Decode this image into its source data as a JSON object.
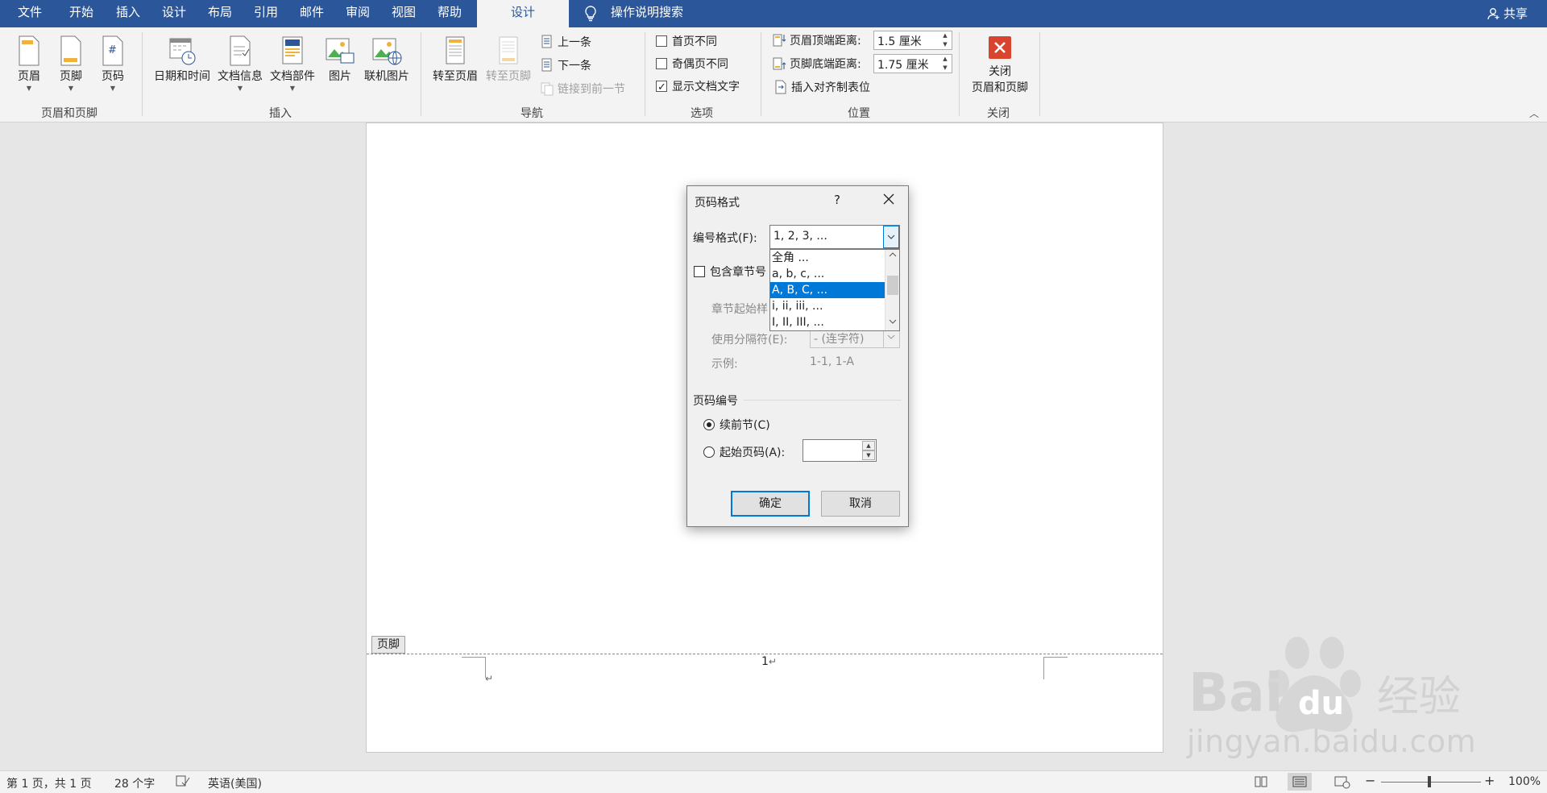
{
  "tabs": [
    "文件",
    "开始",
    "插入",
    "设计",
    "布局",
    "引用",
    "邮件",
    "审阅",
    "视图",
    "帮助",
    "设计"
  ],
  "tell_me": "操作说明搜索",
  "share": "共享",
  "ribbon": {
    "hf": {
      "header": "页眉",
      "footer": "页脚",
      "pagenum": "页码",
      "label": "页眉和页脚"
    },
    "insert": {
      "datetime": "日期和时间",
      "docinfo": "文档信息",
      "quickparts": "文档部件",
      "picture": "图片",
      "online_picture": "联机图片",
      "label": "插入"
    },
    "nav": {
      "goto_header": "转至页眉",
      "goto_footer": "转至页脚",
      "previous": "上一条",
      "next": "下一条",
      "link_prev": "链接到前一节",
      "label": "导航"
    },
    "options": {
      "diff_first": "首页不同",
      "diff_odd_even": "奇偶页不同",
      "show_doc_text": "显示文档文字",
      "label": "选项"
    },
    "position": {
      "header_top": "页眉顶端距离:",
      "header_top_val": "1.5 厘米",
      "footer_bottom": "页脚底端距离:",
      "footer_bottom_val": "1.75 厘米",
      "align_tab": "插入对齐制表位",
      "label": "位置"
    },
    "close": {
      "line1": "关闭",
      "line2": "页眉和页脚",
      "label": "关闭"
    }
  },
  "doc": {
    "footer_tag": "页脚",
    "page_number": "1"
  },
  "dialog": {
    "title": "页码格式",
    "help": "?",
    "format_label": "编号格式(F):",
    "format_value": "1, 2, 3, ...",
    "format_options": [
      "全角 ...",
      "a, b, c, ...",
      "A, B, C, ...",
      "i, ii, iii, ...",
      "I, II, III, ..."
    ],
    "include_chapter": "包含章节号",
    "chapter_start": "章节起始样",
    "separator_label": "使用分隔符(E):",
    "separator_value": "-  (连字符)",
    "example_label": "示例:",
    "example_value": "1-1, 1-A",
    "numbering_group": "页码编号",
    "continue_prev": "续前节(C)",
    "start_at": "起始页码(A):",
    "ok": "确定",
    "cancel": "取消"
  },
  "watermark": {
    "text": "jingyan.baidu.com"
  },
  "status": {
    "page": "第 1 页，共 1 页",
    "words": "28 个字",
    "language": "英语(美国)",
    "zoom": "100%"
  }
}
